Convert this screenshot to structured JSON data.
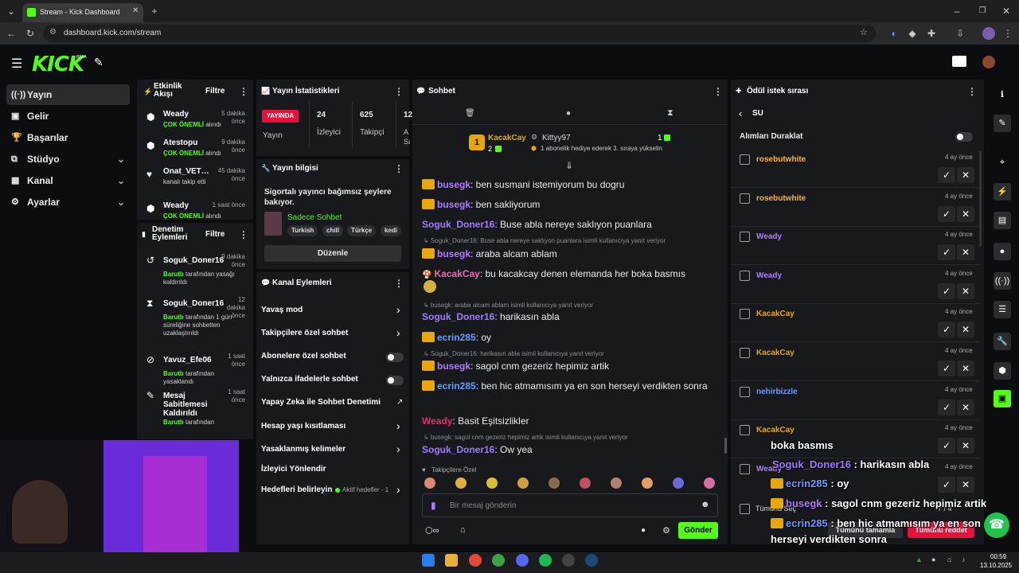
{
  "browser": {
    "tab_title": "Stream - Kick Dashboard",
    "url": "dashboard.kick.com/stream"
  },
  "header": {
    "logo": "KICK",
    "beta": "BETA"
  },
  "sidebar": {
    "items": [
      {
        "label": "Yayın",
        "icon": "broadcast-icon",
        "active": true
      },
      {
        "label": "Gelir",
        "icon": "wallet-icon"
      },
      {
        "label": "Başarılar",
        "icon": "trophy-icon"
      },
      {
        "label": "Stüdyo",
        "icon": "studio-icon",
        "expand": true
      },
      {
        "label": "Kanal",
        "icon": "channel-icon",
        "expand": true
      },
      {
        "label": "Ayarlar",
        "icon": "gear-icon",
        "expand": true
      }
    ]
  },
  "activity": {
    "title": "Etkinlik Akışı",
    "filter": "Filtre",
    "items": [
      {
        "name": "Weady",
        "time": "5 dakika önce",
        "hl": "ÇOK ÖNEMLİ",
        "rest": "alındı"
      },
      {
        "name": "Atestopu",
        "time": "9 dakika önce",
        "hl": "ÇOK ÖNEMLİ",
        "rest": "alındı"
      },
      {
        "name": "Onat_VETTEL",
        "time": "45 dakika önce",
        "hl": "",
        "rest": "kanalı takip etti"
      },
      {
        "name": "Weady",
        "time": "1 saat önce",
        "hl": "ÇOK ÖNEMLİ",
        "rest": "alındı"
      }
    ]
  },
  "moderation": {
    "title": "Denetim Eylemleri",
    "filter": "Filtre",
    "items": [
      {
        "name": "Soguk_Doner16",
        "time": "9 dakika önce",
        "mod": "Barutb",
        "text": "tarafından yasağı kaldırıldı"
      },
      {
        "name": "Soguk_Doner16",
        "time": "12 dakika önce",
        "mod": "Barutb",
        "text": "tarafından 1 gün süreliğine sohbetten uzaklaştırıldı"
      },
      {
        "name": "Yavuz_Efe06",
        "time": "1 saat önce",
        "mod": "Barutb",
        "text": "tarafından yasaklandı"
      },
      {
        "name": "Mesaj Sabitlemesi Kaldırıldı",
        "time": "1 saat önce",
        "mod": "Barutb",
        "text": "tarafından"
      }
    ]
  },
  "stats": {
    "title": "Yayın İstatistikleri",
    "live": "YAYINDA",
    "status_label": "Yayın",
    "viewers": "24",
    "viewers_label": "İzleyici",
    "followers": "625",
    "followers_label": "Takipçi",
    "extra": "12",
    "extra_label": "A Sa"
  },
  "info": {
    "title": "Yayın bilgisi",
    "stream_title": "Sigortalı yayıncı bağımsız şeylere bakıyor.",
    "category": "Sadece Sohbet",
    "tags": [
      "Turkish",
      "chill",
      "Türkçe",
      "kedi"
    ],
    "edit": "Düzenle"
  },
  "channel_actions": {
    "title": "Kanal Eylemleri",
    "items": [
      {
        "label": "Yavaş mod",
        "kind": "chevron"
      },
      {
        "label": "Takipçilere özel sohbet",
        "kind": "chevron"
      },
      {
        "label": "Abonelere özel sohbet",
        "kind": "toggle"
      },
      {
        "label": "Yalnızca ifadelerle sohbet",
        "kind": "toggle"
      },
      {
        "label": "Yapay Zeka ile Sohbet Denetimi",
        "kind": "external"
      },
      {
        "label": "Hesap yaşı kısıtlaması",
        "kind": "chevron"
      },
      {
        "label": "Yasaklanmış kelimeler",
        "kind": "chevron"
      },
      {
        "label": "İzleyici Yönlendir",
        "kind": "none"
      },
      {
        "label": "Hedefleri belirleyin",
        "kind": "goal"
      }
    ],
    "goal_status": "Aktif hedefler - 1"
  },
  "chat": {
    "title": "Sohbet",
    "pinned": {
      "user": "KacakCay",
      "rank": "1",
      "count": "2",
      "gifter": "Kittyy97",
      "gifter_count": "1",
      "note": "1 abonelik hediye ederek 3. sıraya yükselin"
    },
    "messages": [
      {
        "user": "busegk",
        "color": "#b07cff",
        "crown": true,
        "text": "ben susmani istemiyorum bu dogru"
      },
      {
        "user": "busegk",
        "color": "#b07cff",
        "crown": true,
        "text": "ben sakliyorum"
      },
      {
        "user": "Soguk_Doner16",
        "color": "#a07cff",
        "crown": false,
        "text": "Buse abla nereye saklıyon puanlara"
      },
      {
        "reply": "Soguk_Doner16: Buse abla nereye saklıyon puanlara isimli kullanıcıya yanıt veriyor"
      },
      {
        "user": "busegk",
        "color": "#b07cff",
        "crown": true,
        "text": "araba alcam ablam"
      },
      {
        "user": "KacakCay",
        "color": "#e070b0",
        "crown": false,
        "text": "bu kacakcay denen elemanda her boka basmıs"
      },
      {
        "reply": "busegk: araba alcam ablam isimli kullanıcıya yanıt veriyor"
      },
      {
        "user": "Soguk_Doner16",
        "color": "#a07cff",
        "crown": false,
        "text": "harikasın abla"
      },
      {
        "user": "ecrin285",
        "color": "#6b9cff",
        "crown": true,
        "text": "oy"
      },
      {
        "reply": "Soguk_Doner16: harikasın abla isimli kullanıcıya yanıt veriyor"
      },
      {
        "user": "busegk",
        "color": "#b07cff",
        "crown": true,
        "text": "sagol cnm gezeriz hepimiz artik"
      },
      {
        "user": "ecrin285",
        "color": "#6b9cff",
        "crown": true,
        "text": "ben hic atmamısım ya en son herseyi verdikten sonra"
      },
      {
        "user": "Weady",
        "color": "#e0336b",
        "crown": false,
        "text": "Basit Eşitsizlikler"
      },
      {
        "reply": "busegk: sagol cnm gezeriz hepimiz artik isimli kullanıcıya yanıt veriyor"
      },
      {
        "user": "Soguk_Doner16",
        "color": "#a07cff",
        "crown": false,
        "text": "Ow yea"
      }
    ],
    "emote_label": "Takipçilere Özel",
    "placeholder": "Bir mesaj gönderin",
    "send": "Gönder"
  },
  "rewards": {
    "title": "Ödül istek sırası",
    "back": "SU",
    "pause": "Alımları Duraklat",
    "items": [
      {
        "name": "rosebutwhite",
        "color": "#ffb23e",
        "time": "4 ay önce"
      },
      {
        "name": "rosebutwhite",
        "color": "#ffb23e",
        "time": "4 ay önce"
      },
      {
        "name": "Weady",
        "color": "#b07cff",
        "time": "4 ay önce"
      },
      {
        "name": "Weady",
        "color": "#b07cff",
        "time": "4 ay önce"
      },
      {
        "name": "KacakCay",
        "color": "#e8a70c",
        "time": "4 ay önce"
      },
      {
        "name": "KacakCay",
        "color": "#e8a70c",
        "time": "4 ay önce"
      },
      {
        "name": "nehirbizzle",
        "color": "#6b9cff",
        "time": "4 ay önce"
      },
      {
        "name": "KacakCay",
        "color": "#e8a70c",
        "time": "4 ay önce"
      },
      {
        "name": "Weady",
        "color": "#b07cff",
        "time": "4 ay önce"
      }
    ],
    "select_all": "Tümünü Seç",
    "count": "7 / 4",
    "accept_all": "Tümünü tamamla",
    "reject_all": "Tümünü reddet"
  },
  "overlay": [
    {
      "user": "",
      "text": "boka basmıs",
      "color": "#fff"
    },
    {
      "user": "Soguk_Doner16",
      "text": " : harikasın abla",
      "color": "#a07cff"
    },
    {
      "user": "ecrin285",
      "text": " : oy",
      "color": "#6b9cff"
    },
    {
      "user": "busegk",
      "text": " : sagol cnm gezeriz hepimiz artik",
      "color": "#b07cff"
    },
    {
      "user": "ecrin285",
      "text": " : ben hic atmamısım ya en son",
      "color": "#6b9cff"
    },
    {
      "user": "",
      "text": "herseyi verdikten sonra",
      "color": "#fff"
    },
    {
      "user": "Weady",
      "text": " : Basit Eşitsizlikler",
      "color": "#e0336b"
    }
  ],
  "taskbar": {
    "time": "00:59",
    "date": "13.10.2025"
  }
}
